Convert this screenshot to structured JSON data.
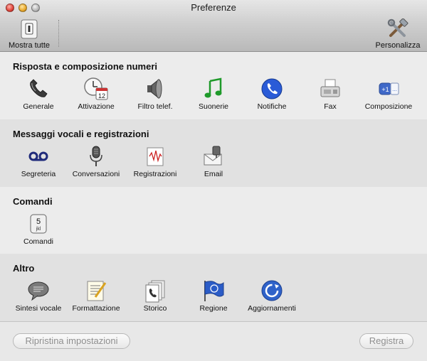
{
  "window": {
    "title": "Preferenze"
  },
  "toolbar": {
    "show_all": "Mostra tutte",
    "customize": "Personalizza"
  },
  "sections": [
    {
      "title": "Risposta e composizione numeri",
      "items": [
        {
          "label": "Generale",
          "icon": "phone-handset-icon"
        },
        {
          "label": "Attivazione",
          "icon": "clock-calendar-icon"
        },
        {
          "label": "Filtro telef.",
          "icon": "speaker-icon"
        },
        {
          "label": "Suonerie",
          "icon": "music-note-icon"
        },
        {
          "label": "Notifiche",
          "icon": "notification-phone-icon"
        },
        {
          "label": "Fax",
          "icon": "fax-icon"
        },
        {
          "label": "Composizione",
          "icon": "dial-plus1-icon"
        }
      ]
    },
    {
      "title": "Messaggi vocali e registrazioni",
      "items": [
        {
          "label": "Segreteria",
          "icon": "voicemail-icon"
        },
        {
          "label": "Conversazioni",
          "icon": "microphone-icon"
        },
        {
          "label": "Registrazioni",
          "icon": "recording-icon"
        },
        {
          "label": "Email",
          "icon": "email-icon"
        }
      ]
    },
    {
      "title": "Comandi",
      "items": [
        {
          "label": "Comandi",
          "icon": "keypad-5-icon",
          "key_digit": "5",
          "key_letters": "jkl"
        }
      ]
    },
    {
      "title": "Altro",
      "items": [
        {
          "label": "Sintesi vocale",
          "icon": "speech-bubble-icon"
        },
        {
          "label": "Formattazione",
          "icon": "formatting-icon"
        },
        {
          "label": "Storico",
          "icon": "history-icon"
        },
        {
          "label": "Regione",
          "icon": "region-flag-icon"
        },
        {
          "label": "Aggiornamenti",
          "icon": "update-icon"
        }
      ]
    }
  ],
  "footer": {
    "reset": "Ripristina impostazioni",
    "save": "Registra"
  },
  "colors": {
    "accent_blue": "#2a5bd7",
    "green": "#1f9a2a",
    "traffic_red": "#e0443a",
    "traffic_yellow": "#e7a72a"
  }
}
